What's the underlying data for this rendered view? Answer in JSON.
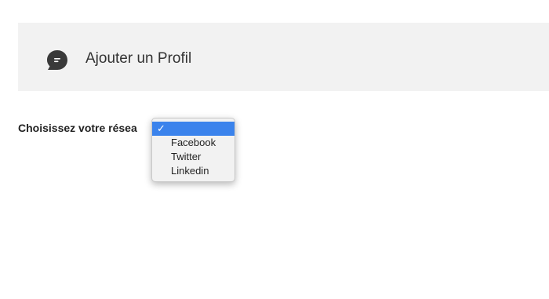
{
  "header": {
    "title": "Ajouter un Profil",
    "icon": "chat-bubble-icon",
    "icon_color": "#3a3a3a"
  },
  "form": {
    "network_label": "Choisissez votre résea"
  },
  "dropdown": {
    "selected_mark": "✓",
    "accent": "#3b83ec",
    "options": [
      {
        "label": ""
      },
      {
        "label": "Facebook"
      },
      {
        "label": "Twitter"
      },
      {
        "label": "Linkedin"
      }
    ]
  }
}
